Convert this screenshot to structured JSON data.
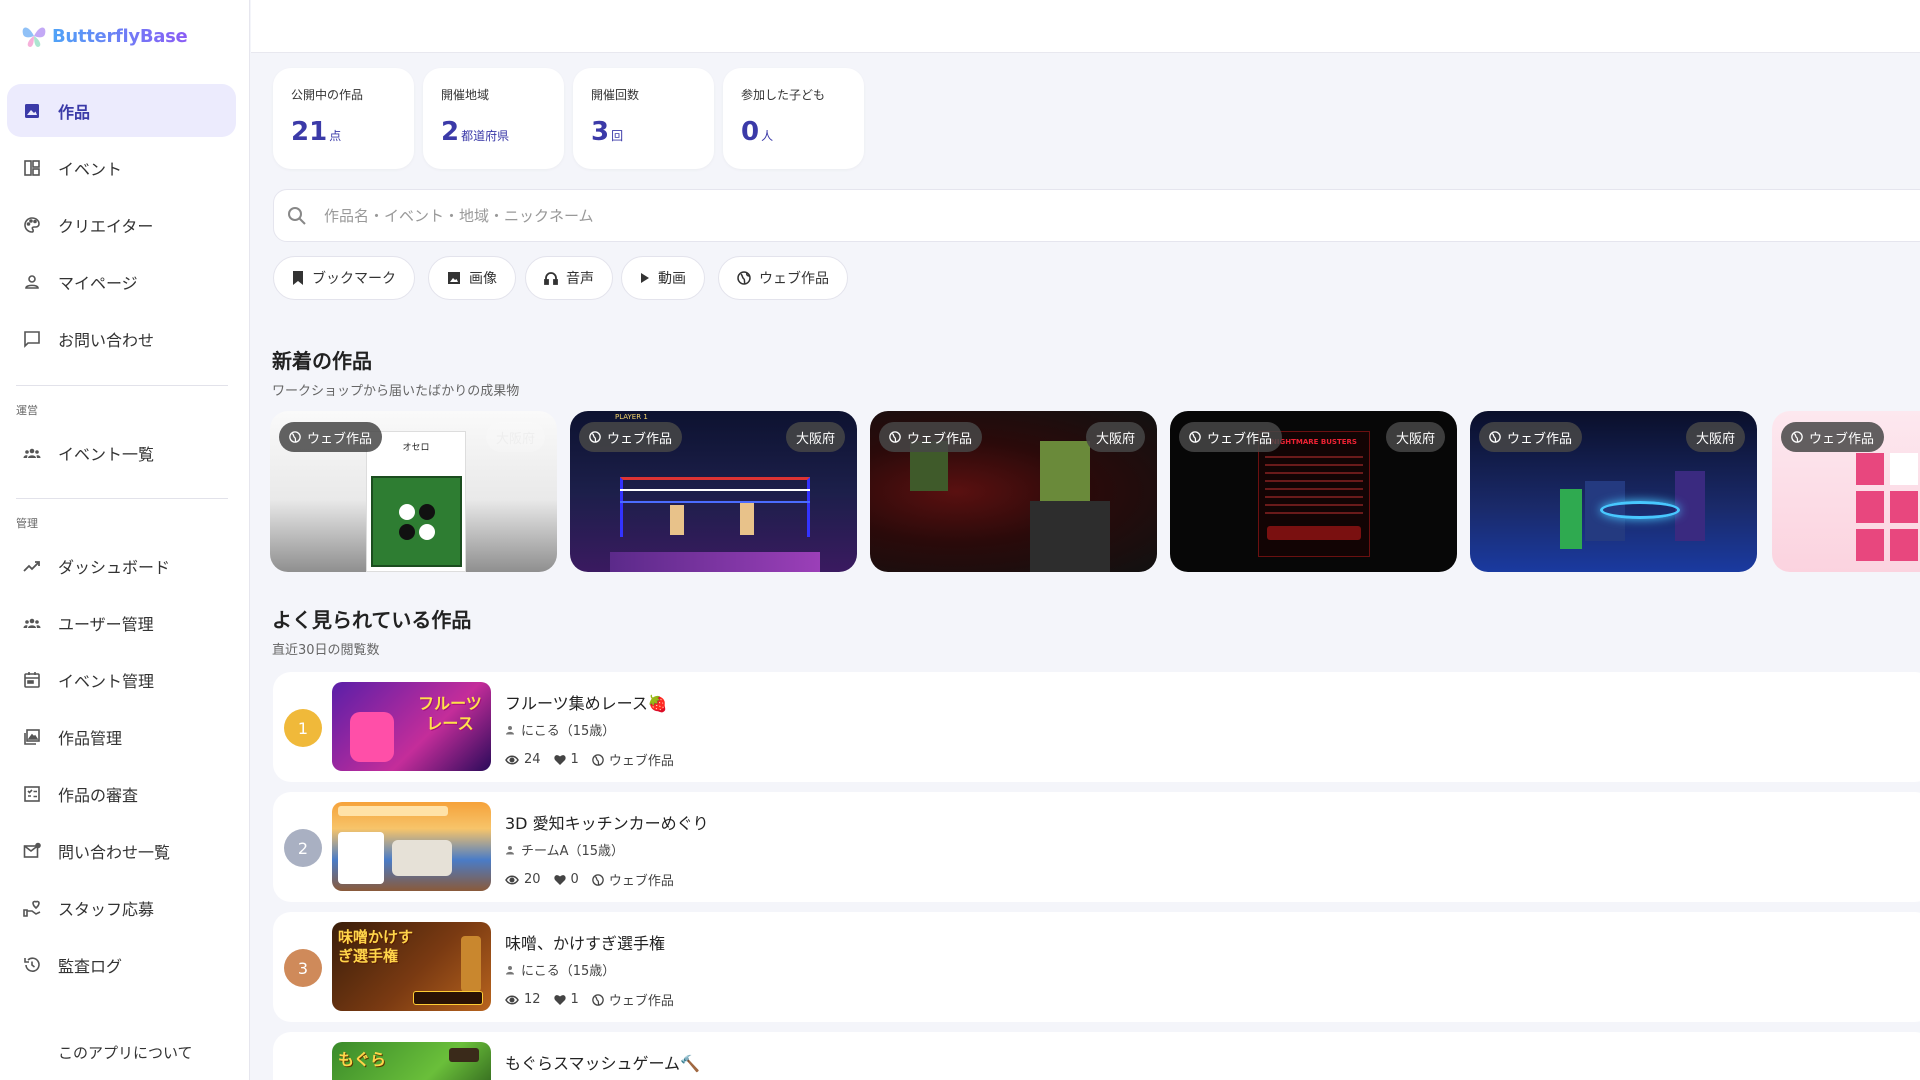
{
  "app": {
    "name": "ButterflyBase"
  },
  "sidebar": {
    "main_items": [
      {
        "label": "作品",
        "icon": "image-icon"
      },
      {
        "label": "イベント",
        "icon": "dashboard-icon"
      },
      {
        "label": "クリエイター",
        "icon": "palette-icon"
      },
      {
        "label": "マイページ",
        "icon": "person-icon"
      },
      {
        "label": "お問い合わせ",
        "icon": "chat-icon"
      }
    ],
    "ops_label": "運営",
    "ops_items": [
      {
        "label": "イベント一覧",
        "icon": "group-icon"
      }
    ],
    "admin_label": "管理",
    "admin_items": [
      {
        "label": "ダッシュボード",
        "icon": "trend-icon"
      },
      {
        "label": "ユーザー管理",
        "icon": "group-icon"
      },
      {
        "label": "イベント管理",
        "icon": "calendar-icon"
      },
      {
        "label": "作品管理",
        "icon": "gallery-icon"
      },
      {
        "label": "作品の審査",
        "icon": "checklist-icon"
      },
      {
        "label": "問い合わせ一覧",
        "icon": "mail-icon"
      },
      {
        "label": "スタッフ応募",
        "icon": "volunteer-icon"
      },
      {
        "label": "監査ログ",
        "icon": "history-icon"
      }
    ],
    "about": "このアプリについて"
  },
  "stats": [
    {
      "label": "公開中の作品",
      "value": "21",
      "unit": "点"
    },
    {
      "label": "開催地域",
      "value": "2",
      "unit": "都道府県"
    },
    {
      "label": "開催回数",
      "value": "3",
      "unit": "回"
    },
    {
      "label": "参加した子ども",
      "value": "0",
      "unit": "人"
    }
  ],
  "search": {
    "placeholder": "作品名・イベント・地域・ニックネーム"
  },
  "filters": [
    "ブックマーク",
    "画像",
    "音声",
    "動画",
    "ウェブ作品"
  ],
  "new_works": {
    "title": "新着の作品",
    "subtitle": "ワークショップから届いたばかりの成果物",
    "cards": [
      {
        "type": "ウェブ作品",
        "region": "大阪府",
        "thumb_text": "オセロ"
      },
      {
        "type": "ウェブ作品",
        "region": "大阪府",
        "thumb_text": "PLAYER 1"
      },
      {
        "type": "ウェブ作品",
        "region": "大阪府",
        "thumb_text": ""
      },
      {
        "type": "ウェブ作品",
        "region": "大阪府",
        "thumb_text": "NIGHTMARE BUSTERS"
      },
      {
        "type": "ウェブ作品",
        "region": "大阪府",
        "thumb_text": ""
      },
      {
        "type": "ウェブ作品",
        "region": "",
        "thumb_text": ""
      }
    ]
  },
  "popular": {
    "title": "よく見られている作品",
    "subtitle": "直近30日の閲覧数",
    "items": [
      {
        "rank": "1",
        "title": "フルーツ集めレース🍓",
        "author": "にこる（15歳）",
        "views": "24",
        "likes": "1",
        "type": "ウェブ作品",
        "thumb_text": "フルーツレース"
      },
      {
        "rank": "2",
        "title": "3D 愛知キッチンカーめぐり",
        "author": "チームA（15歳）",
        "views": "20",
        "likes": "0",
        "type": "ウェブ作品",
        "thumb_text": ""
      },
      {
        "rank": "3",
        "title": "味噌、かけすぎ選手権",
        "author": "にこる（15歳）",
        "views": "12",
        "likes": "1",
        "type": "ウェブ作品",
        "thumb_text": "味噌かけすぎ選手権"
      },
      {
        "rank": "",
        "title": "もぐらスマッシュゲーム🔨",
        "author": "",
        "views": "",
        "likes": "",
        "type": "",
        "thumb_text": "もぐら"
      }
    ]
  },
  "colors": {
    "accent": "#3b3aa8",
    "gold": "#f0b93a",
    "silver": "#a9b0c2",
    "bronze": "#cf8a5a"
  }
}
